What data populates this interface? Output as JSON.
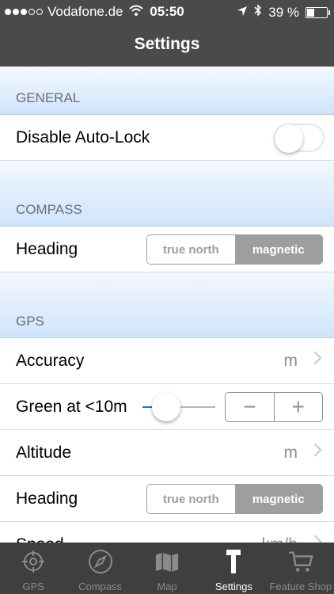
{
  "status_bar": {
    "carrier": "Vodafone.de",
    "time": "05:50",
    "battery": "39 %"
  },
  "nav": {
    "title": "Settings"
  },
  "sections": {
    "general": {
      "header": "GENERAL",
      "auto_lock_label": "Disable Auto-Lock",
      "auto_lock_on": false
    },
    "compass": {
      "header": "COMPASS",
      "heading_label": "Heading",
      "options": [
        "true north",
        "magnetic"
      ],
      "selected": "magnetic"
    },
    "gps": {
      "header": "GPS",
      "accuracy_label": "Accuracy",
      "accuracy_unit": "m",
      "green_label": "Green at <10m",
      "green_slider_value": 0.33,
      "altitude_label": "Altitude",
      "altitude_unit": "m",
      "heading_label": "Heading",
      "heading_options": [
        "true north",
        "magnetic"
      ],
      "heading_selected": "magnetic",
      "speed_label": "Speed",
      "speed_unit": "km/h"
    }
  },
  "tabs": [
    {
      "label": "GPS",
      "icon": "crosshair-icon"
    },
    {
      "label": "Compass",
      "icon": "compass-icon"
    },
    {
      "label": "Map",
      "icon": "map-icon"
    },
    {
      "label": "Settings",
      "icon": "hammer-icon",
      "active": true
    },
    {
      "label": "Feature Shop",
      "icon": "cart-icon"
    }
  ],
  "colors": {
    "bar": "#4a4a4a",
    "tabbar": "#3f3f3f",
    "accent": "#007aff",
    "section_gradient_top": "#f3f8ff",
    "section_gradient_bottom": "#cfe4fb"
  }
}
